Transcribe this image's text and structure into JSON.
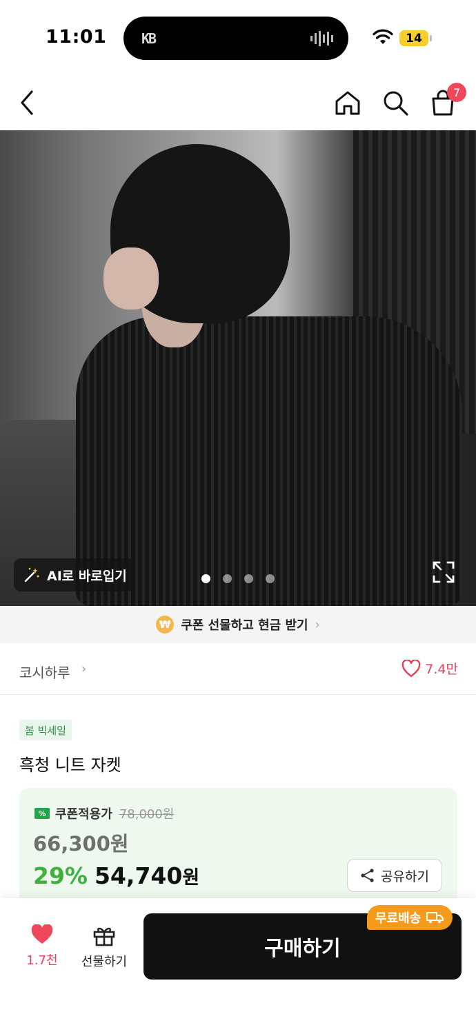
{
  "status_bar": {
    "time": "11:01",
    "battery": "14",
    "island_logo": "KB"
  },
  "nav": {
    "cart_count": "7",
    "icons": [
      "back-icon",
      "home-icon",
      "search-icon",
      "shopping-bag-icon"
    ]
  },
  "hero": {
    "ai_button_label": "AI로 바로입기",
    "carousel_count": 4,
    "carousel_active_index": 0
  },
  "coupon_strip": {
    "label": "쿠폰 선물하고 현금 받기",
    "coin_symbol": "₩"
  },
  "brand": {
    "name": "코시하루",
    "chevron": "›",
    "likes": "7.4만"
  },
  "product": {
    "tag": "봄 빅세일",
    "title": "흑청 니트 자켓"
  },
  "price": {
    "coupon_label": "쿠폰적용가",
    "original_price": "78,000원",
    "intermediate_price": "66,300원",
    "discount": "29%",
    "final_number": "54,740",
    "final_unit": "원",
    "share_label": "공유하기"
  },
  "bottom": {
    "like_count": "1.7천",
    "gift_label": "선물하기",
    "buy_label": "구매하기",
    "free_shipping": "무료배송"
  },
  "colors": {
    "accent_green": "#3db33d",
    "like_red": "#e8405a",
    "badge_red": "#f0475a",
    "free_ship_orange": "#f59b1b"
  }
}
